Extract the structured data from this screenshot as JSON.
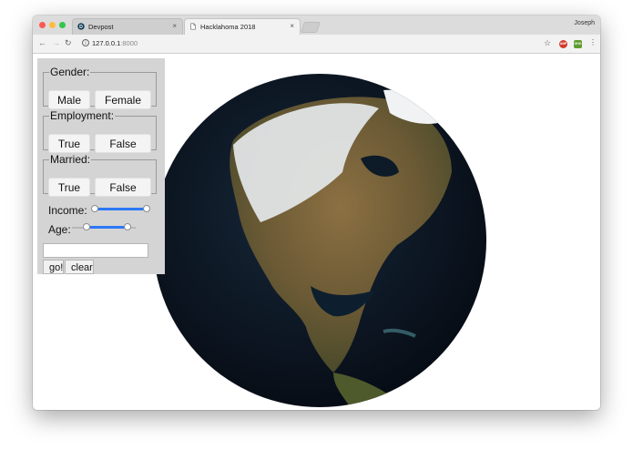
{
  "browser": {
    "tabs": [
      {
        "label": "Devpost",
        "active": false
      },
      {
        "label": "Hacklahoma 2018",
        "active": true
      }
    ],
    "profile": "Joseph",
    "url_host": "127.0.0.1",
    "url_port": ":8000",
    "extensions": [
      "ABP",
      "GHO"
    ]
  },
  "panel": {
    "gender": {
      "legend": "Gender:",
      "options": [
        "Male",
        "Female"
      ]
    },
    "employment": {
      "legend": "Employment:",
      "options": [
        "True",
        "False"
      ]
    },
    "married": {
      "legend": "Married:",
      "options": [
        "True",
        "False"
      ]
    },
    "income": {
      "label": "Income:",
      "range": [
        0,
        1
      ]
    },
    "age": {
      "label": "Age:",
      "range": [
        0.2,
        0.92
      ]
    },
    "text_input": {
      "value": ""
    },
    "go_label": "go!",
    "clear_label": "clear"
  },
  "colors": {
    "slider_accent": "#2d78f6",
    "panel_bg": "#d4d4d4",
    "globe_ocean": "#0b1420"
  }
}
